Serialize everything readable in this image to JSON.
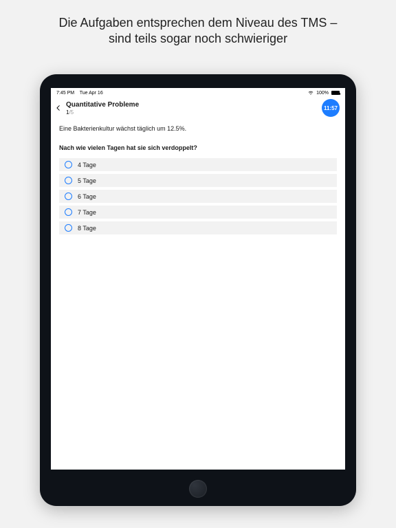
{
  "promo": {
    "line1": "Die Aufgaben entsprechen dem Niveau des TMS –",
    "line2": "sind teils sogar noch schwieriger"
  },
  "statusbar": {
    "time": "7:45 PM",
    "date": "Tue Apr 16",
    "battery_pct": "100%"
  },
  "appbar": {
    "title": "Quantitative Probleme",
    "progress_current": "1",
    "progress_total": "/5",
    "timer": "11:57"
  },
  "quiz": {
    "prompt": "Eine Bakterienkultur wächst täglich um 12.5%.",
    "question": "Nach wie vielen Tagen hat sie sich verdoppelt?",
    "options": [
      "4 Tage",
      "5 Tage",
      "6 Tage",
      "7 Tage",
      "8 Tage"
    ]
  },
  "colors": {
    "accent": "#1d7dff"
  }
}
